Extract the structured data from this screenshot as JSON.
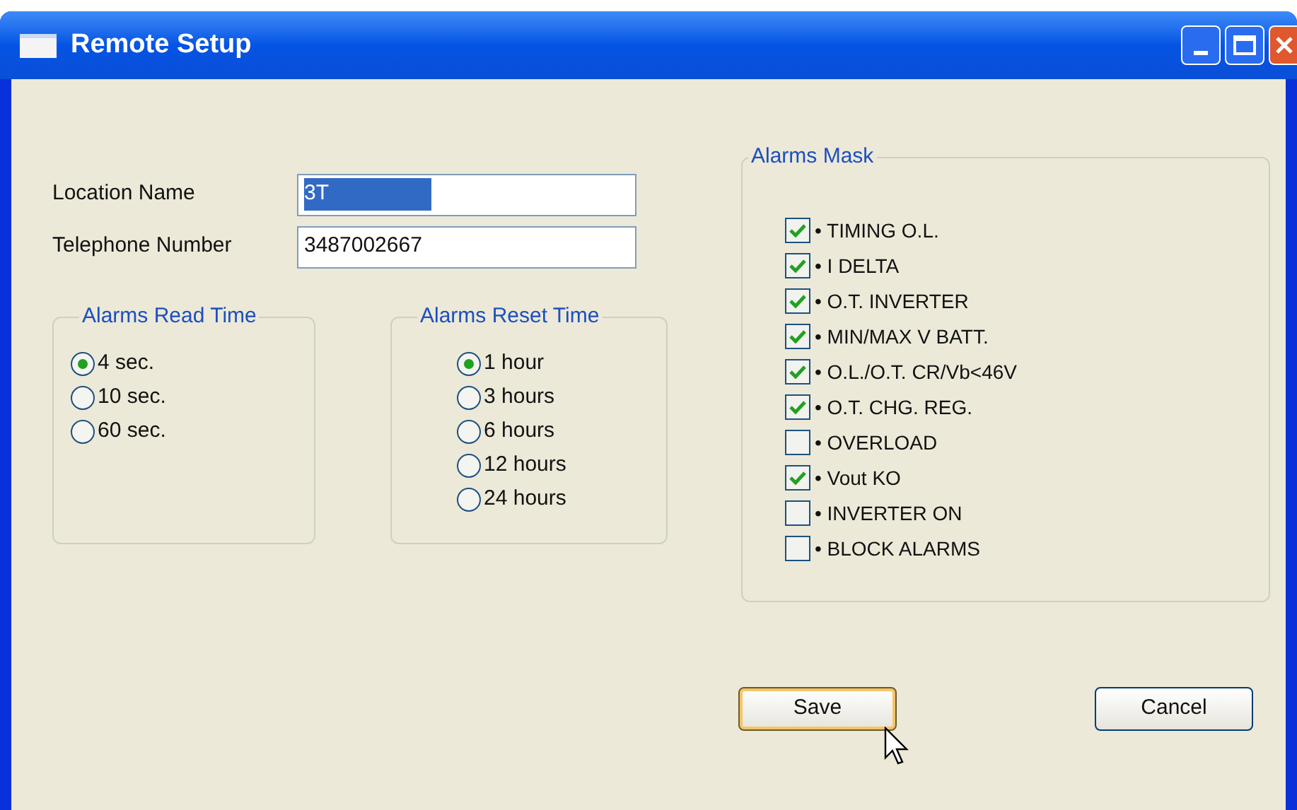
{
  "window": {
    "title": "Remote Setup"
  },
  "fields": [
    {
      "label": "Location Name",
      "value": "3T",
      "selected": true
    },
    {
      "label": "Telephone Number",
      "value": "3487002667",
      "selected": false
    }
  ],
  "read_time": {
    "title": "Alarms Read Time",
    "options": [
      {
        "label": "4 sec.",
        "selected": true
      },
      {
        "label": "10 sec.",
        "selected": false
      },
      {
        "label": "60 sec.",
        "selected": false
      }
    ]
  },
  "reset_time": {
    "title": "Alarms Reset Time",
    "options": [
      {
        "label": "1 hour",
        "selected": true
      },
      {
        "label": "3 hours",
        "selected": false
      },
      {
        "label": "6 hours",
        "selected": false
      },
      {
        "label": "12 hours",
        "selected": false
      },
      {
        "label": "24 hours",
        "selected": false
      }
    ]
  },
  "alarms_mask": {
    "title": "Alarms Mask",
    "items": [
      {
        "label": "• TIMING O.L.",
        "checked": true
      },
      {
        "label": "• I DELTA",
        "checked": true
      },
      {
        "label": "• O.T. INVERTER",
        "checked": true
      },
      {
        "label": "• MIN/MAX V BATT.",
        "checked": true
      },
      {
        "label": "• O.L./O.T. CR/Vb<46V",
        "checked": true
      },
      {
        "label": "• O.T. CHG. REG.",
        "checked": true
      },
      {
        "label": "• OVERLOAD",
        "checked": false
      },
      {
        "label": "• Vout KO",
        "checked": true
      },
      {
        "label": "• INVERTER ON",
        "checked": false
      },
      {
        "label": "• BLOCK ALARMS",
        "checked": false
      }
    ]
  },
  "buttons": [
    {
      "label": "Save",
      "selected": true
    },
    {
      "label": "Cancel",
      "selected": false
    }
  ]
}
